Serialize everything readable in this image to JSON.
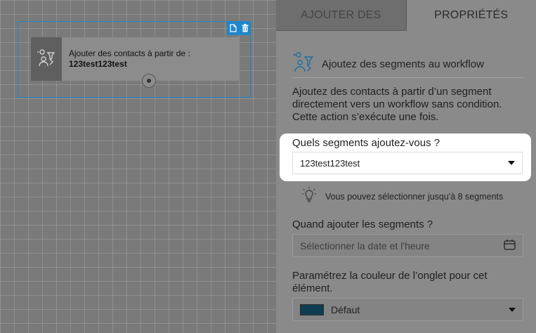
{
  "canvas": {
    "node": {
      "line1": "Ajouter des contacts à partir de :",
      "line2": "123test123test"
    }
  },
  "tabs": {
    "add": "AJOUTER DES",
    "properties": "PROPRIÉTÉS",
    "active": "properties"
  },
  "section": {
    "title": "Ajoutez des segments au workflow",
    "description": "Ajoutez des contacts à partir d’un segment directement vers un workflow sans condition. Cette action s’exécute une fois."
  },
  "segments": {
    "label": "Quels segments ajoutez-vous ?",
    "selected": "123test123test",
    "hint": "Vous pouvez sélectionner jusqu'à 8 segments"
  },
  "schedule": {
    "label": "Quand ajouter les segments ?",
    "placeholder": "Sélectionner la date et l'heure"
  },
  "tab_color": {
    "label": "Paramétrez la couleur de l’onglet pour cet élément.",
    "selected": "Défaut",
    "swatch": "#0e3d52"
  },
  "colors": {
    "selection_blue": "#1e87c9"
  }
}
